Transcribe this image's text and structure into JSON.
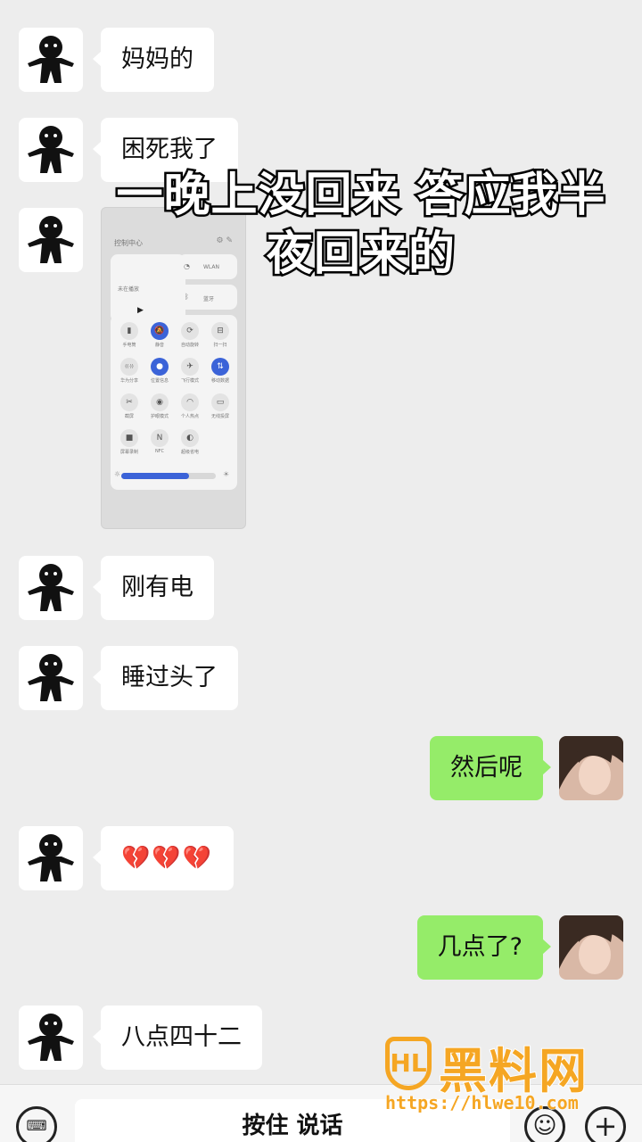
{
  "messages": [
    {
      "side": "left",
      "text": "妈妈的"
    },
    {
      "side": "left",
      "text": "困死我了"
    },
    {
      "side": "left",
      "text": "刚有电"
    },
    {
      "side": "left",
      "text": "睡过头了"
    },
    {
      "side": "right",
      "text": "然后呢"
    },
    {
      "side": "left",
      "text": "💔💔💔"
    },
    {
      "side": "right",
      "text": "几点了?"
    },
    {
      "side": "left",
      "text": "八点四十二"
    }
  ],
  "screenshot": {
    "title": "控制中心",
    "media_label": "未在播放",
    "wifi_label": "WLAN",
    "bt_label": "蓝牙",
    "tiles": [
      {
        "label": "手电筒",
        "icon": "flashlight-icon",
        "on": false
      },
      {
        "label": "静音",
        "icon": "mute-icon",
        "on": true
      },
      {
        "label": "自动旋转",
        "icon": "rotate-icon",
        "on": false
      },
      {
        "label": "扫一扫",
        "icon": "scan-icon",
        "on": false
      },
      {
        "label": "华为分享",
        "icon": "share-icon",
        "on": false
      },
      {
        "label": "位置信息",
        "icon": "location-icon",
        "on": true
      },
      {
        "label": "飞行模式",
        "icon": "airplane-icon",
        "on": false
      },
      {
        "label": "移动数据",
        "icon": "data-icon",
        "on": true
      },
      {
        "label": "截屏",
        "icon": "screenshot-icon",
        "on": false
      },
      {
        "label": "护眼模式",
        "icon": "eye-icon",
        "on": false
      },
      {
        "label": "个人热点",
        "icon": "hotspot-icon",
        "on": false
      },
      {
        "label": "无线投屏",
        "icon": "cast-icon",
        "on": false
      },
      {
        "label": "屏幕录制",
        "icon": "record-icon",
        "on": false
      },
      {
        "label": "NFC",
        "icon": "nfc-icon",
        "on": false
      },
      {
        "label": "超级省电",
        "icon": "power-save-icon",
        "on": false
      }
    ],
    "brightness": 0.72
  },
  "caption": {
    "line1": "一晚上没回来 答应我半",
    "line2": "夜回来的"
  },
  "watermark": {
    "logo": "HL",
    "name": "黑料网",
    "url": "https://hlwe10.com"
  },
  "input_bar": {
    "hold_to_talk": "按住 说话"
  },
  "colors": {
    "background": "#ededed",
    "self_bubble": "#95ec69",
    "other_bubble": "#ffffff",
    "accent": "#3b63d8",
    "watermark": "#f5a623"
  }
}
